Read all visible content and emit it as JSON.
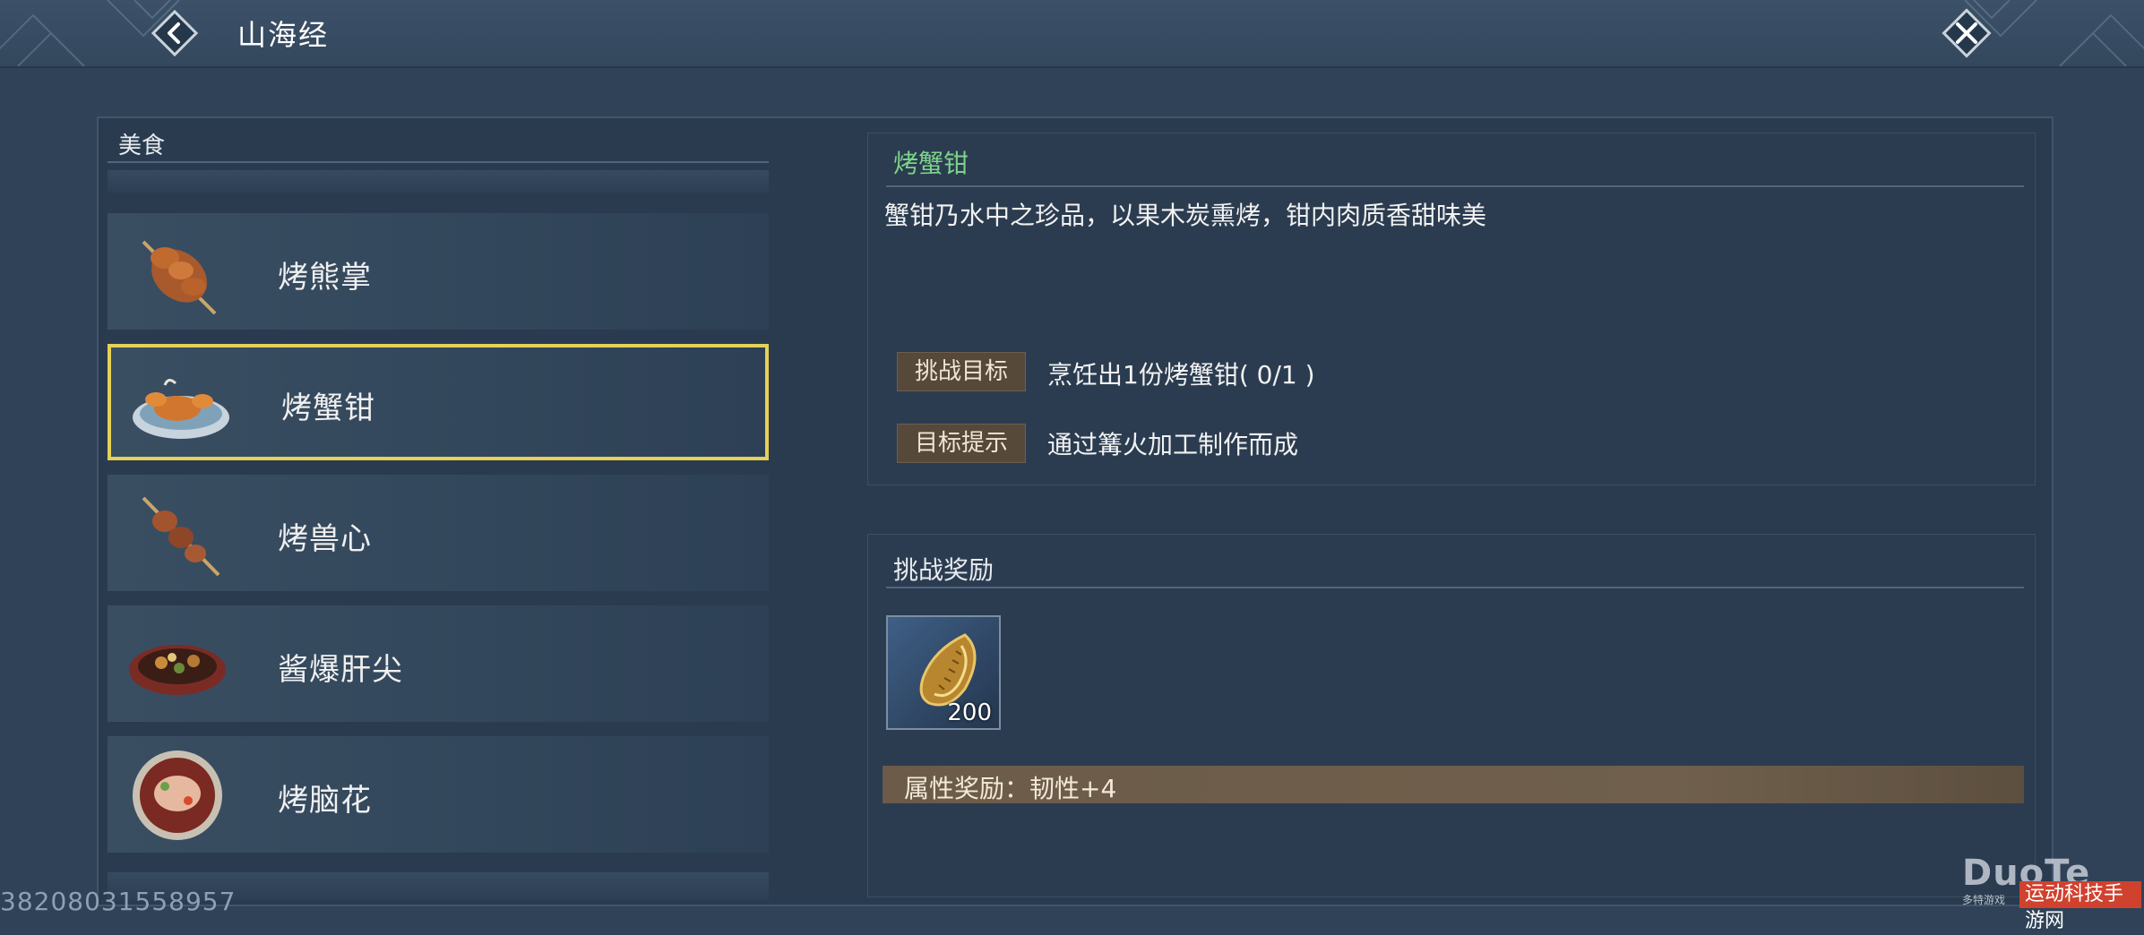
{
  "header": {
    "title": "山海经"
  },
  "list": {
    "category_label": "美食",
    "items": [
      {
        "name": "烤熊掌",
        "icon": "roasted-bear-paw-icon",
        "selected": false
      },
      {
        "name": "烤蟹钳",
        "icon": "roasted-crab-claw-icon",
        "selected": true
      },
      {
        "name": "烤兽心",
        "icon": "roasted-beast-heart-icon",
        "selected": false
      },
      {
        "name": "酱爆肝尖",
        "icon": "sauce-fried-liver-icon",
        "selected": false
      },
      {
        "name": "烤脑花",
        "icon": "roasted-brain-icon",
        "selected": false
      }
    ]
  },
  "detail": {
    "title": "烤蟹钳",
    "description": "蟹钳乃水中之珍品，以果木炭熏烤，钳内肉质香甜味美",
    "challenge_label": "挑战目标",
    "challenge_value": "烹饪出1份烤蟹钳( 0/1 )",
    "hint_label": "目标提示",
    "hint_value": "通过篝火加工制作而成"
  },
  "reward": {
    "title": "挑战奖励",
    "item_icon": "golden-shell-icon",
    "item_count": "200",
    "attribute_text": "属性奖励：韧性+4"
  },
  "footer": {
    "id_text": "38208031558957"
  },
  "watermark": {
    "logo": "DuoTe",
    "badge": "运动科技手游网",
    "sub": "多特游戏"
  },
  "colors": {
    "background": "#2f4257",
    "selected_border": "#e6d158",
    "title_green": "#7cd38a",
    "tag_bg": "#57493a"
  }
}
